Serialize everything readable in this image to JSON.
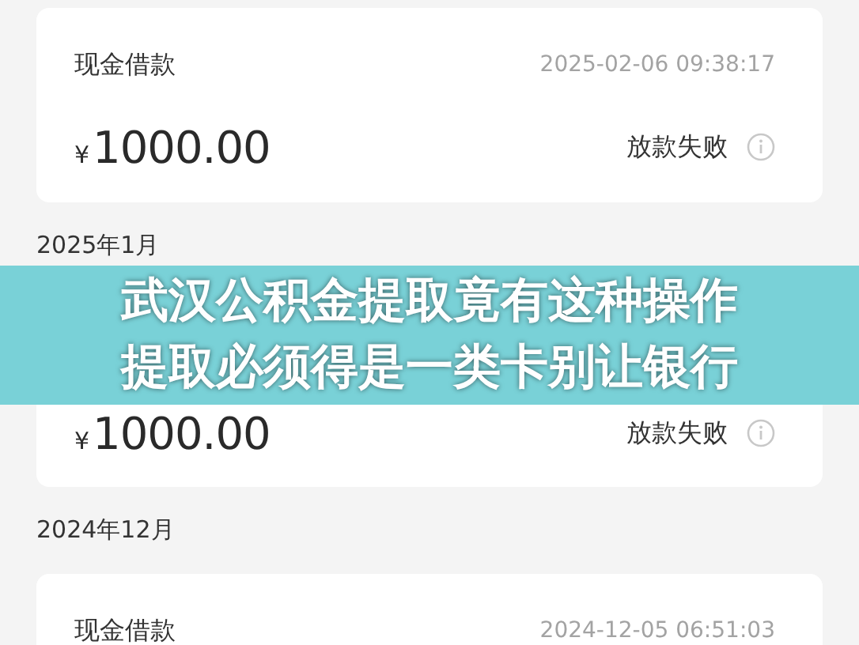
{
  "sections": [
    {
      "records": [
        {
          "title": "现金借款",
          "time": "2025-02-06 09:38:17",
          "currency": "¥",
          "amount": "1000.00",
          "status": "放款失败"
        }
      ]
    },
    {
      "month": "2025年1月",
      "records": [
        {
          "currency": "¥",
          "amount": "1000.00",
          "status": "放款失败"
        }
      ]
    },
    {
      "month": "2024年12月",
      "records": [
        {
          "title": "现金借款",
          "time": "2024-12-05 06:51:03"
        }
      ]
    }
  ],
  "banner": {
    "lines": [
      "武汉公积金提取竟有这种操作",
      "提取必须得是一类卡别让银行"
    ]
  }
}
